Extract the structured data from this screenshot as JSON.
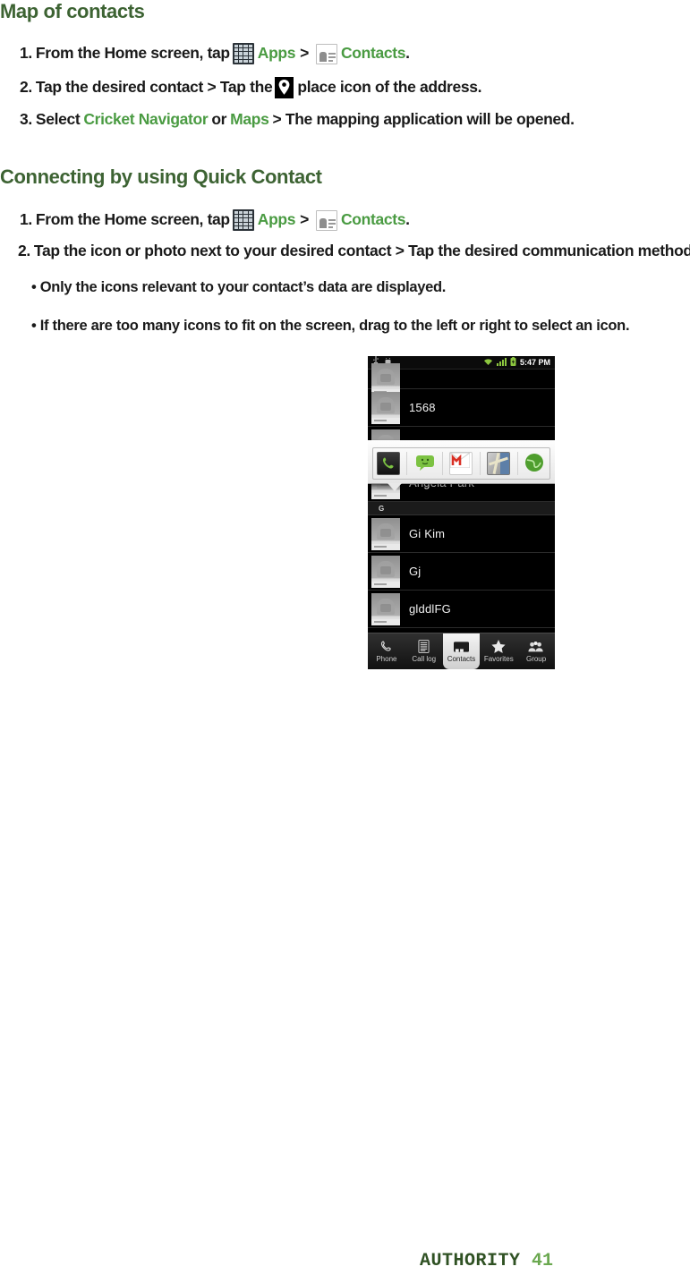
{
  "sections": [
    {
      "heading": "Map of contacts",
      "steps": [
        {
          "number": "1.",
          "pre": "From the Home screen, tap",
          "apps_label": "Apps",
          "separator": ">",
          "contacts_label": "Contacts",
          "post": "."
        },
        {
          "number": "2.",
          "pre": "Tap the desired contact > Tap the",
          "post": "place icon of the address."
        },
        {
          "number": "3.",
          "pre": "Select",
          "link1": "Cricket Navigator",
          "mid": "or",
          "link2": "Maps",
          "post": "> The mapping application will be opened."
        }
      ]
    },
    {
      "heading": "Connecting by using Quick Contact",
      "steps": [
        {
          "number": "1.",
          "pre": "From the Home screen, tap",
          "apps_label": "Apps",
          "separator": ">",
          "contacts_label": "Contacts",
          "post": "."
        },
        {
          "number": "2.",
          "text": "Tap the icon or photo next to your desired contact > Tap the desired communication method."
        }
      ],
      "bullets": [
        "• Only the icons relevant to your contact’s data are displayed.",
        "• If there are too many icons to fit on the screen, drag to the left or right to select an icon."
      ]
    }
  ],
  "phone_screenshot": {
    "status_bar": {
      "time": "5:47 PM",
      "left_icons": [
        "usb-icon",
        "android-debug-icon"
      ],
      "right_icons": [
        "wifi-icon",
        "signal-icon",
        "battery-icon"
      ]
    },
    "contacts": [
      {
        "name": "",
        "partial_top": true
      },
      {
        "name": "1568"
      },
      {
        "name": ""
      },
      {
        "name": "Angela Park"
      }
    ],
    "section_letter": "G",
    "contacts_after": [
      {
        "name": "Gi Kim"
      },
      {
        "name": "Gj"
      },
      {
        "name": "glddlFG",
        "partial_bottom": true
      }
    ],
    "quick_contact_icons": [
      "phone-icon",
      "message-icon",
      "gmail-icon",
      "maps-icon",
      "browser-icon"
    ],
    "tabs": [
      {
        "label": "Phone",
        "icon": "phone-handset-icon",
        "selected": false
      },
      {
        "label": "Call log",
        "icon": "call-log-icon",
        "selected": false
      },
      {
        "label": "Contacts",
        "icon": "contacts-icon",
        "selected": true
      },
      {
        "label": "Favorites",
        "icon": "star-icon",
        "selected": false
      },
      {
        "label": "Group",
        "icon": "group-icon",
        "selected": false
      }
    ]
  },
  "footer": {
    "brand": "AUTHORITY",
    "page_number": "41"
  },
  "colors": {
    "heading_green": "#3d6333",
    "link_green": "#4a9b42",
    "footer_brand": "#2f5123",
    "footer_page": "#6aa84f",
    "body_text": "#1a1a1a"
  }
}
